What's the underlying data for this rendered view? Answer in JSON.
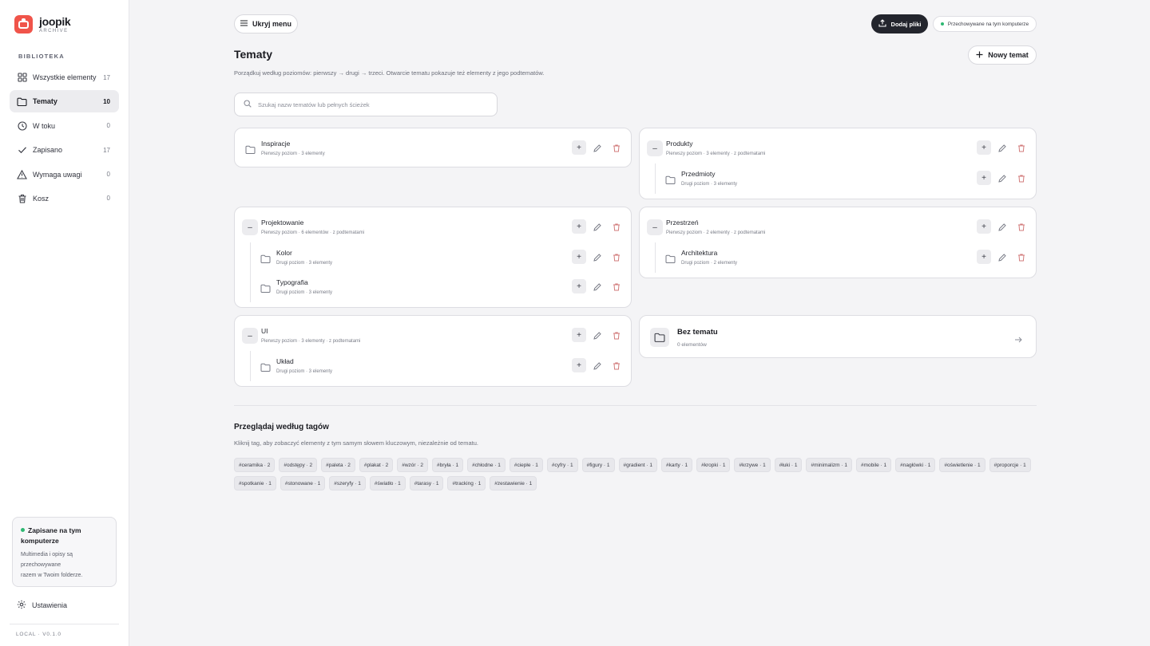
{
  "app": {
    "name": "joopik",
    "subtitle": "ARCHIVE",
    "version": "LOCAL · V0.1.0"
  },
  "sidebar": {
    "section_label": "BIBLIOTEKA",
    "items": [
      {
        "label": "Wszystkie elementy",
        "count": "17",
        "icon": "grid-icon"
      },
      {
        "label": "Tematy",
        "count": "10",
        "icon": "folder-icon",
        "active": true
      },
      {
        "label": "W toku",
        "count": "0",
        "icon": "clock-icon"
      },
      {
        "label": "Zapisano",
        "count": "17",
        "icon": "check-icon"
      },
      {
        "label": "Wymaga uwagi",
        "count": "0",
        "icon": "warning-icon"
      },
      {
        "label": "Kosz",
        "count": "0",
        "icon": "trash-icon"
      }
    ],
    "storage": {
      "title": "Zapisane na tym komputerze",
      "desc_line1": "Multimedia i opisy są przechowywane",
      "desc_line2": "razem w Twoim folderze."
    },
    "settings_label": "Ustawienia"
  },
  "header": {
    "menu_button": "Ukryj menu",
    "add_files": "Dodaj pliki",
    "storage_status": "Przechowywane na tym komputerze"
  },
  "main": {
    "title": "Tematy",
    "description": "Porządkuj według poziomów: pierwszy → drugi → trzeci. Otwarcie tematu pokazuje też elementy z jego podtematów.",
    "new_topic_button": "Nowy temat",
    "search_placeholder": "Szukaj nazw tematów lub pełnych ścieżek"
  },
  "topics": {
    "inspiracje": {
      "name": "Inspiracje",
      "meta": "Pierwszy poziom · 3 elementy"
    },
    "produkty": {
      "name": "Produkty",
      "meta": "Pierwszy poziom · 3 elementy · z podtematami"
    },
    "przedmioty": {
      "name": "Przedmioty",
      "meta": "Drugi poziom · 3 elementy"
    },
    "projektowanie": {
      "name": "Projektowanie",
      "meta": "Pierwszy poziom · 6 elementów · z podtematami"
    },
    "kolor": {
      "name": "Kolor",
      "meta": "Drugi poziom · 3 elementy"
    },
    "typografia": {
      "name": "Typografia",
      "meta": "Drugi poziom · 3 elementy"
    },
    "przestrzen": {
      "name": "Przestrzeń",
      "meta": "Pierwszy poziom · 2 elementy · z podtematami"
    },
    "architektura": {
      "name": "Architektura",
      "meta": "Drugi poziom · 2 elementy"
    },
    "ui": {
      "name": "UI",
      "meta": "Pierwszy poziom · 3 elementy · z podtematami"
    },
    "uklad": {
      "name": "Układ",
      "meta": "Drugi poziom · 3 elementy"
    },
    "bez_tematu": {
      "name": "Bez tematu",
      "meta": "0 elementów"
    }
  },
  "tags_section": {
    "title": "Przeglądaj według tagów",
    "description": "Kliknij tag, aby zobaczyć elementy z tym samym słowem kluczowym, niezależnie od tematu.",
    "tags": [
      "#ceramika · 2",
      "#odstępy · 2",
      "#paleta · 2",
      "#plakat · 2",
      "#wzór · 2",
      "#bryła · 1",
      "#chłodne · 1",
      "#ciepłe · 1",
      "#cyfry · 1",
      "#figury · 1",
      "#gradient · 1",
      "#karty · 1",
      "#kropki · 1",
      "#krzywe · 1",
      "#łuki · 1",
      "#minimalizm · 1",
      "#mobile · 1",
      "#nagłówki · 1",
      "#oświetlenie · 1",
      "#proporcje · 1",
      "#spotkanie · 1",
      "#stonowane · 1",
      "#szeryfy · 1",
      "#światło · 1",
      "#tarasy · 1",
      "#tracking · 1",
      "#zestawienie · 1"
    ]
  }
}
